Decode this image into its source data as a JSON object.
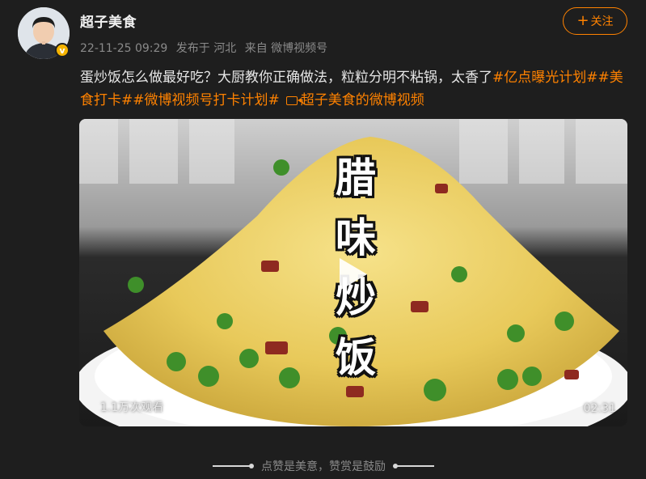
{
  "author": {
    "name": "超子美食",
    "verified_icon": "verified-v-badge",
    "verified_label": "v"
  },
  "meta": {
    "timestamp": "22-11-25 09:29",
    "published_at": "发布于 河北",
    "source": "来自 微博视频号"
  },
  "follow_button": {
    "plus": "+",
    "label": "关注"
  },
  "post": {
    "text": "蛋炒饭怎么做最好吃？大厨教你正确做法，粒粒分明不粘锅，太香了",
    "tags": [
      "#亿点曝光计划#",
      "#美食打卡#",
      "#微博视频号打卡计划#"
    ],
    "video_link_label": "超子美食的微博视频"
  },
  "video": {
    "overlay_title": [
      "腊",
      "味",
      "炒",
      "饭"
    ],
    "view_count": "1.1万次观看",
    "duration": "02:31"
  },
  "footer": {
    "reward_text": "点赞是美意，赞赏是鼓励"
  },
  "colors": {
    "background": "#1e1e1e",
    "accent": "#ff8200",
    "text": "#e6e6e6",
    "muted": "#8a8a8a"
  }
}
